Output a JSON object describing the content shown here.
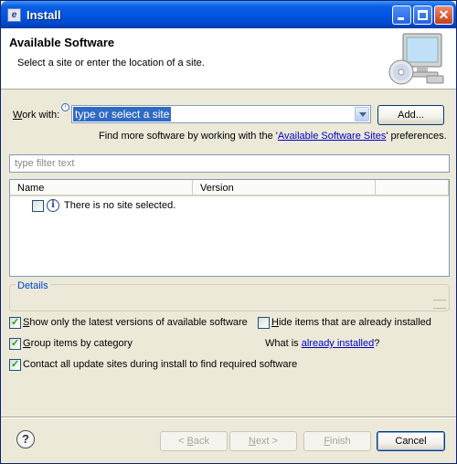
{
  "window": {
    "title": "Install"
  },
  "header": {
    "title": "Available Software",
    "description": "Select a site or enter the location of a site."
  },
  "work_with": {
    "label_mnemonic": "W",
    "label_rest": "ork with:",
    "value": "type or select a site",
    "add_label": "Add..."
  },
  "find_more": {
    "prefix": "Find more software by working with the '",
    "link": "Available Software Sites",
    "suffix": "' preferences."
  },
  "filter": {
    "placeholder": "type filter text"
  },
  "table": {
    "columns": [
      "Name",
      "Version"
    ],
    "rows": [
      {
        "text": "There is no site selected.",
        "checked": false
      }
    ]
  },
  "details": {
    "label": "Details"
  },
  "options": {
    "show_latest": {
      "mnemonic": "S",
      "rest": "how only the latest versions of available software",
      "checked": true
    },
    "hide_installed": {
      "mnemonic": "H",
      "rest": "ide items that are already installed",
      "checked": false
    },
    "group_by_category": {
      "mnemonic": "G",
      "rest": "roup items by category",
      "checked": true
    },
    "contact_sites": {
      "text": "Contact all update sites during install to find required software",
      "checked": true
    },
    "what_is_prefix": "What is ",
    "what_is_link": "already installed",
    "what_is_suffix": "?"
  },
  "footer": {
    "help_label": "?",
    "back": {
      "mnemonic": "B",
      "prefix": "< ",
      "rest": "ack"
    },
    "next": {
      "mnemonic": "N",
      "rest": "ext >"
    },
    "finish": {
      "mnemonic": "F",
      "rest": "inish"
    },
    "cancel": "Cancel"
  },
  "colors": {
    "title_bar": "#0054e3",
    "dialog": "#ece9d8",
    "selection": "#316ac5",
    "link": "#0000cc"
  }
}
